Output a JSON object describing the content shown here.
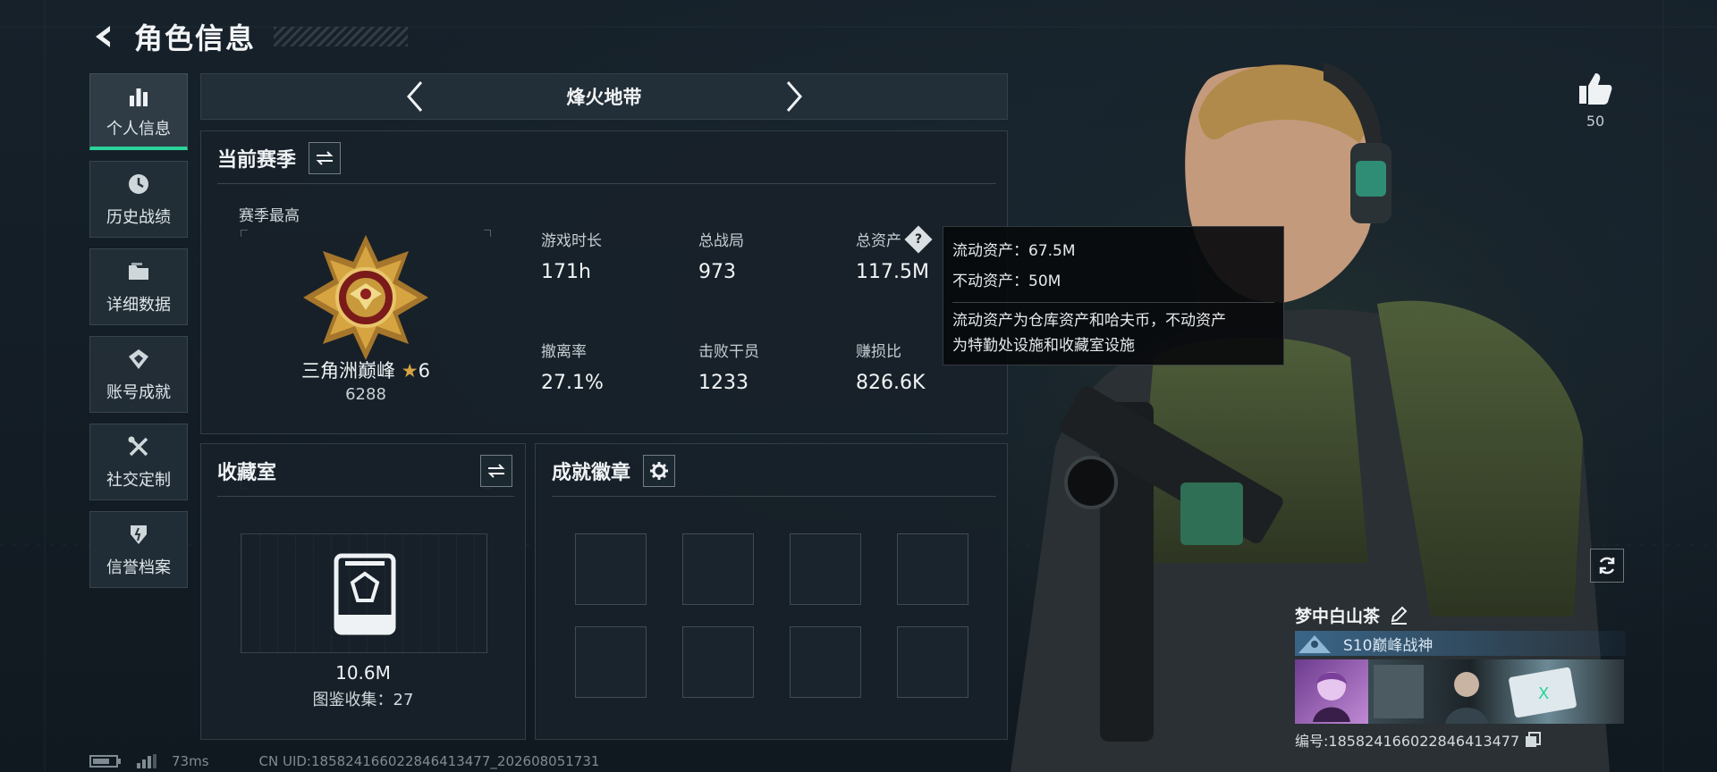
{
  "header": {
    "title": "角色信息"
  },
  "sidebar": {
    "items": [
      {
        "label": "个人信息",
        "icon": "bar-chart-icon",
        "active": true
      },
      {
        "label": "历史战绩",
        "icon": "history-clock-icon",
        "active": false
      },
      {
        "label": "详细数据",
        "icon": "folder-icon",
        "active": false
      },
      {
        "label": "账号成就",
        "icon": "achievement-icon",
        "active": false
      },
      {
        "label": "社交定制",
        "icon": "tools-icon",
        "active": false
      },
      {
        "label": "信誉档案",
        "icon": "shield-icon",
        "active": false
      }
    ]
  },
  "mode": {
    "name": "烽火地带"
  },
  "season": {
    "title": "当前赛季",
    "best_label": "赛季最高",
    "rank_name": "三角洲巅峰",
    "rank_stars": "6",
    "rank_score": "6288",
    "stats": [
      {
        "key": "游戏时长",
        "value": "171h"
      },
      {
        "key": "总战局",
        "value": "973"
      },
      {
        "key": "总资产",
        "value": "117.5M"
      },
      {
        "key": "撤离率",
        "value": "27.1%"
      },
      {
        "key": "击败干员",
        "value": "1233"
      },
      {
        "key": "赚损比",
        "value": "826.6K"
      }
    ]
  },
  "tooltip": {
    "line1": "流动资产：67.5M",
    "line2": "不动资产：50M",
    "desc_line1": "流动资产为仓库资产和哈夫币，不动资产",
    "desc_line2": "为特勤处设施和收藏室设施"
  },
  "collection": {
    "title": "收藏室",
    "value": "10.6M",
    "sub": "图鉴收集：27"
  },
  "badges": {
    "title": "成就徽章"
  },
  "status": {
    "ping": "73ms",
    "uid": "CN UID:185824166022846413477_202608051731"
  },
  "likes": {
    "count": "50"
  },
  "profile": {
    "name": "梦中白山茶",
    "title": "S10巅峰战神",
    "id": "编号:185824166022846413477"
  },
  "colors": {
    "accent": "#2bd49a",
    "gold": "#d6a542",
    "title_blue": "#3c6e96"
  }
}
